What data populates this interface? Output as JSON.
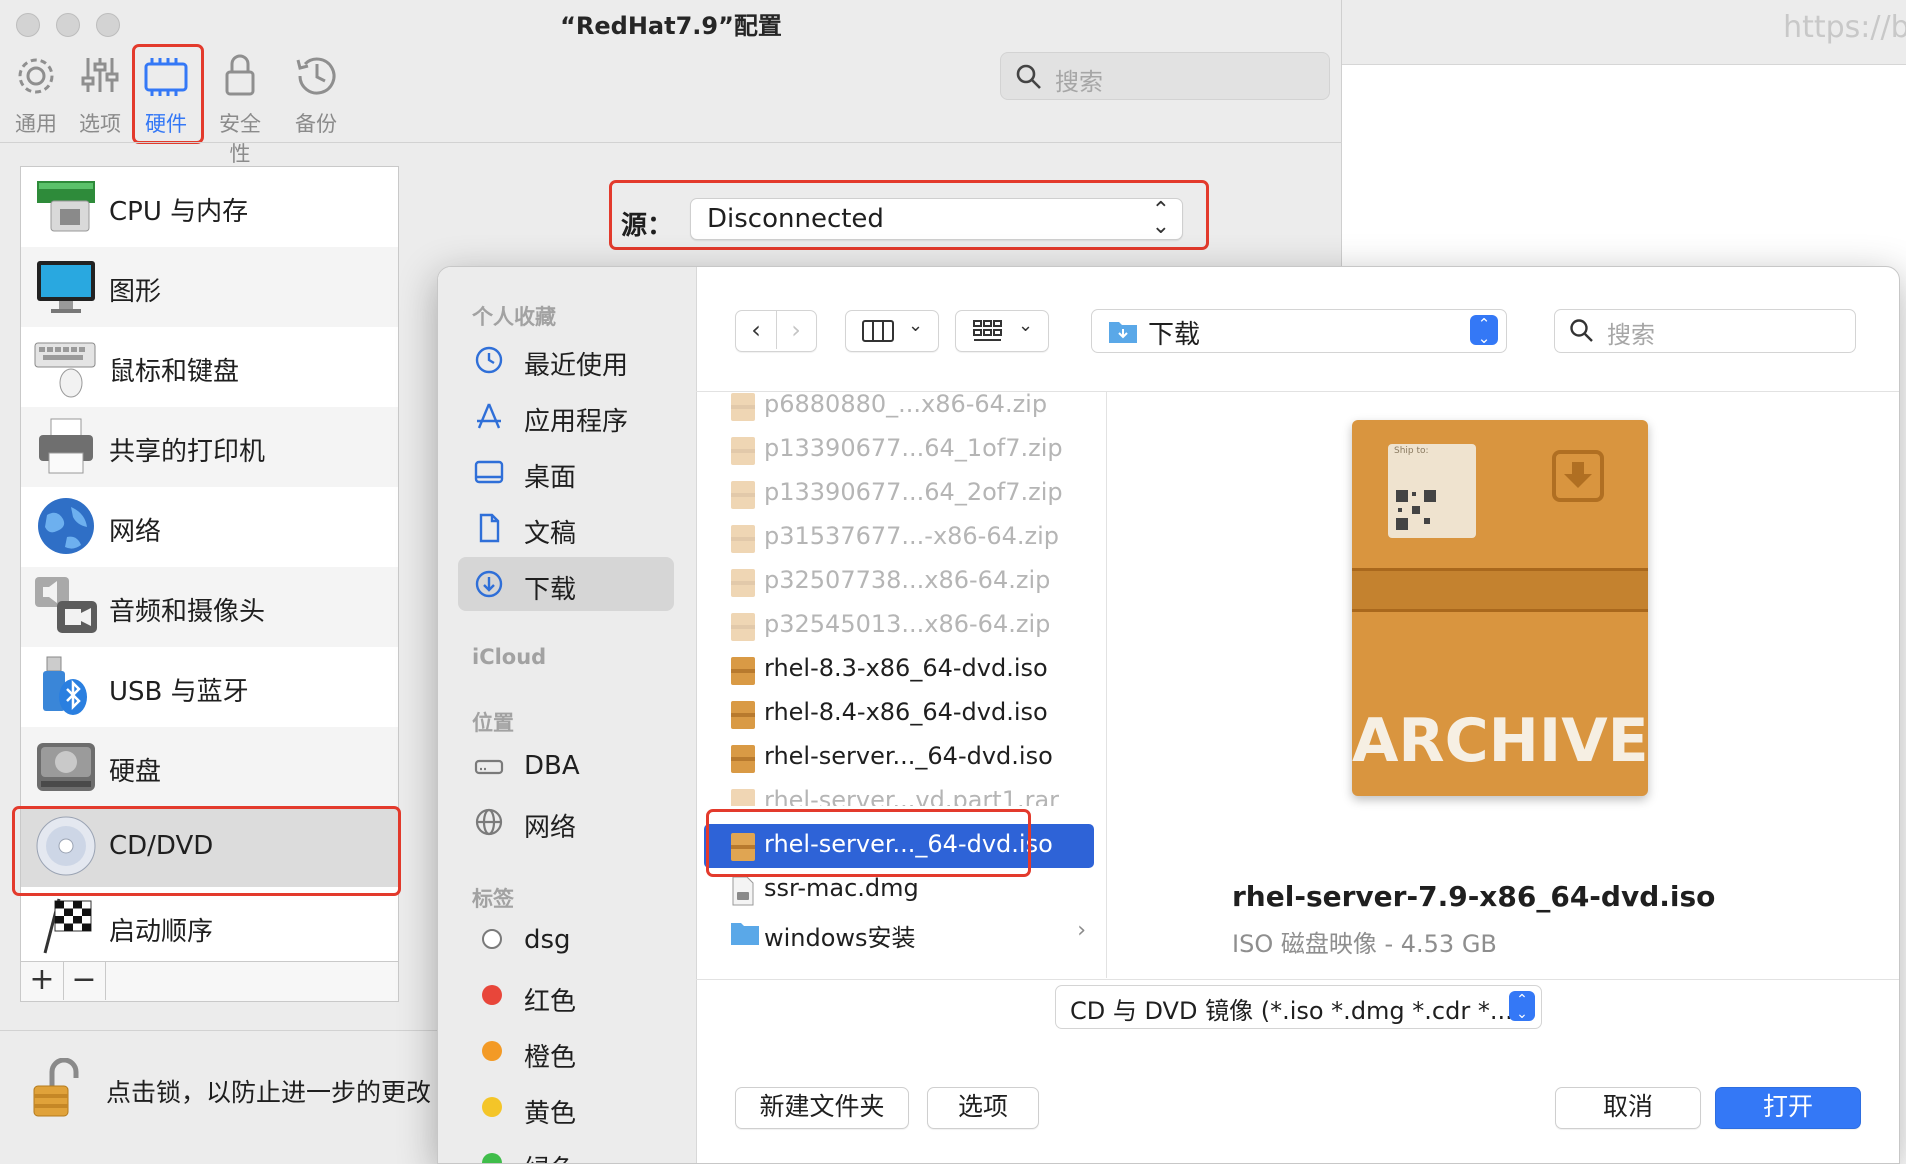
{
  "background_window": {
    "url_fragment": "https://bl"
  },
  "prefs": {
    "title": "“RedHat7.9”配置",
    "toolbar": {
      "items": [
        {
          "label": "通用",
          "icon": "gear-icon"
        },
        {
          "label": "选项",
          "icon": "sliders-icon"
        },
        {
          "label": "硬件",
          "icon": "hardware-chip-icon",
          "selected": true
        },
        {
          "label": "安全性",
          "icon": "lock-icon"
        },
        {
          "label": "备份",
          "icon": "clock-history-icon"
        }
      ],
      "search_placeholder": "搜索"
    },
    "sidebar": {
      "items": [
        {
          "label": "CPU 与内存",
          "icon": "cpu-memory-icon"
        },
        {
          "label": "图形",
          "icon": "monitor-icon"
        },
        {
          "label": "鼠标和键盘",
          "icon": "keyboard-mouse-icon"
        },
        {
          "label": "共享的打印机",
          "icon": "printer-icon"
        },
        {
          "label": "网络",
          "icon": "globe-icon"
        },
        {
          "label": "音频和摄像头",
          "icon": "audio-camera-icon"
        },
        {
          "label": "USB 与蓝牙",
          "icon": "usb-bluetooth-icon"
        },
        {
          "label": "硬盘",
          "icon": "hard-disk-icon"
        },
        {
          "label": "CD/DVD",
          "icon": "cd-dvd-icon",
          "selected": true
        },
        {
          "label": "启动顺序",
          "icon": "checkered-flag-icon"
        }
      ],
      "add_label": "+",
      "remove_label": "−"
    },
    "lock_text": "点击锁，以防止进一步的更改",
    "source": {
      "label": "源：",
      "value": "Disconnected"
    }
  },
  "dialog": {
    "sidebar": {
      "favorites_header": "个人收藏",
      "favorites": [
        {
          "label": "最近使用",
          "icon": "recent-clock-icon"
        },
        {
          "label": "应用程序",
          "icon": "applications-icon"
        },
        {
          "label": "桌面",
          "icon": "desktop-icon"
        },
        {
          "label": "文稿",
          "icon": "document-icon"
        },
        {
          "label": "下载",
          "icon": "download-icon",
          "selected": true
        }
      ],
      "icloud_header": "iCloud",
      "locations_header": "位置",
      "locations": [
        {
          "label": "DBA",
          "icon": "drive-icon"
        },
        {
          "label": "网络",
          "icon": "network-globe-icon"
        }
      ],
      "tags_header": "标签",
      "tags": [
        {
          "label": "dsg",
          "color": ""
        },
        {
          "label": "红色",
          "color": "#e8463a"
        },
        {
          "label": "橙色",
          "color": "#f39a26"
        },
        {
          "label": "黄色",
          "color": "#f4c528"
        },
        {
          "label": "绿色",
          "color": "#3fbd4a"
        }
      ]
    },
    "location": "下载",
    "search_placeholder": "搜索",
    "files": [
      {
        "name": "p6880880_...x86-64.zip",
        "dim": true
      },
      {
        "name": "p13390677...64_1of7.zip",
        "dim": true
      },
      {
        "name": "p13390677...64_2of7.zip",
        "dim": true
      },
      {
        "name": "p31537677...-x86-64.zip",
        "dim": true
      },
      {
        "name": "p32507738...x86-64.zip",
        "dim": true
      },
      {
        "name": "p32545013...x86-64.zip",
        "dim": true
      },
      {
        "name": "rhel-8.3-x86_64-dvd.iso",
        "dim": false
      },
      {
        "name": "rhel-8.4-x86_64-dvd.iso",
        "dim": false
      },
      {
        "name": "rhel-server..._64-dvd.iso",
        "dim": false
      },
      {
        "name": "rhel-server...vd.part1.rar",
        "dim": true
      },
      {
        "name": "rhel-server..._64-dvd.iso",
        "dim": false,
        "selected": true
      },
      {
        "name": "ssr-mac.dmg",
        "dim": false
      },
      {
        "name": "windows安装",
        "dim": false,
        "folder": true
      }
    ],
    "preview": {
      "icon_text": "ARCHIVE",
      "label_ship_to": "Ship to:",
      "name": "rhel-server-7.9-x86_64-dvd.iso",
      "meta": "ISO 磁盘映像 - 4.53 GB"
    },
    "filter": "CD 与 DVD 镜像 (*.iso *.dmg *.cdr *...",
    "buttons": {
      "new_folder": "新建文件夹",
      "options": "选项",
      "cancel": "取消",
      "open": "打开"
    }
  }
}
